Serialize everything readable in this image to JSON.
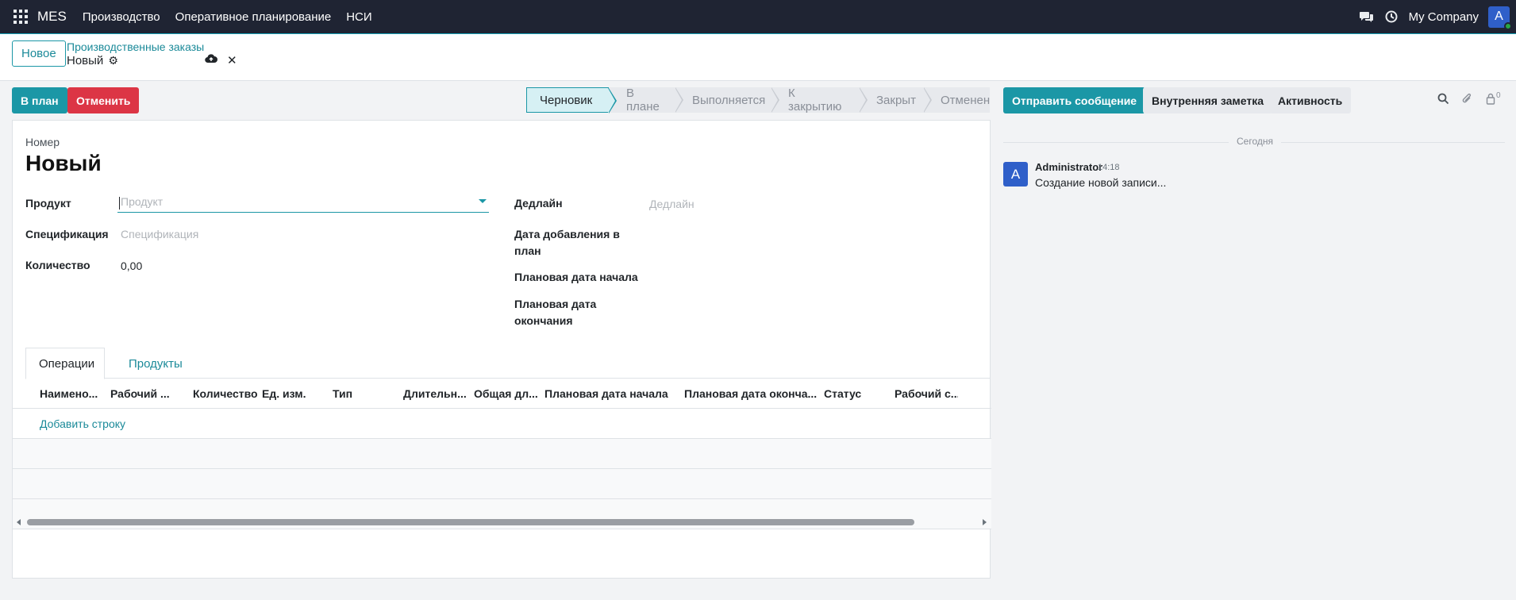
{
  "navbar": {
    "brand": "MES",
    "menu": [
      "Производство",
      "Оперативное планирование",
      "НСИ"
    ],
    "company": "My Company",
    "avatar_letter": "A"
  },
  "control": {
    "new_button": "Новое",
    "breadcrumb_parent": "Производственные заказы",
    "breadcrumb_current": "Новый"
  },
  "actions": {
    "plan": "В план",
    "cancel": "Отменить"
  },
  "statusbar": {
    "stages": [
      "Черновик",
      "В плане",
      "Выполняется",
      "К закрытию",
      "Закрыт",
      "Отменен"
    ],
    "active": "Черновик"
  },
  "form": {
    "number_label": "Номер",
    "title": "Новый",
    "product_label": "Продукт",
    "product_placeholder": "Продукт",
    "spec_label": "Спецификация",
    "spec_placeholder": "Спецификация",
    "qty_label": "Количество",
    "qty_value": "0,00",
    "deadline_label": "Дедлайн",
    "deadline_placeholder": "Дедлайн",
    "date_added_label_1": "Дата добавления в",
    "date_added_label_2": "план",
    "planned_start_label": "Плановая дата начала",
    "planned_end_label_1": "Плановая дата",
    "planned_end_label_2": "окончания"
  },
  "tabs": [
    "Операции",
    "Продукты"
  ],
  "table": {
    "columns": [
      "Наименo...",
      "Рабочий ...",
      "Количество",
      "Ед. изм.",
      "Тип",
      "Длительн...",
      "Общая дл...",
      "Плановая дата начала",
      "Плановая дата оконча...",
      "Статус",
      "Рабочий с..."
    ],
    "add_line": "Добавить строку"
  },
  "chatter": {
    "send_message": "Отправить сообщение",
    "internal_note": "Внутренняя заметка",
    "activity": "Активность",
    "follower_count": "0",
    "today": "Сегодня",
    "messages": [
      {
        "avatar_letter": "A",
        "author": "Administrator",
        "time": "14:18",
        "body": "Создание новой записи..."
      }
    ]
  }
}
